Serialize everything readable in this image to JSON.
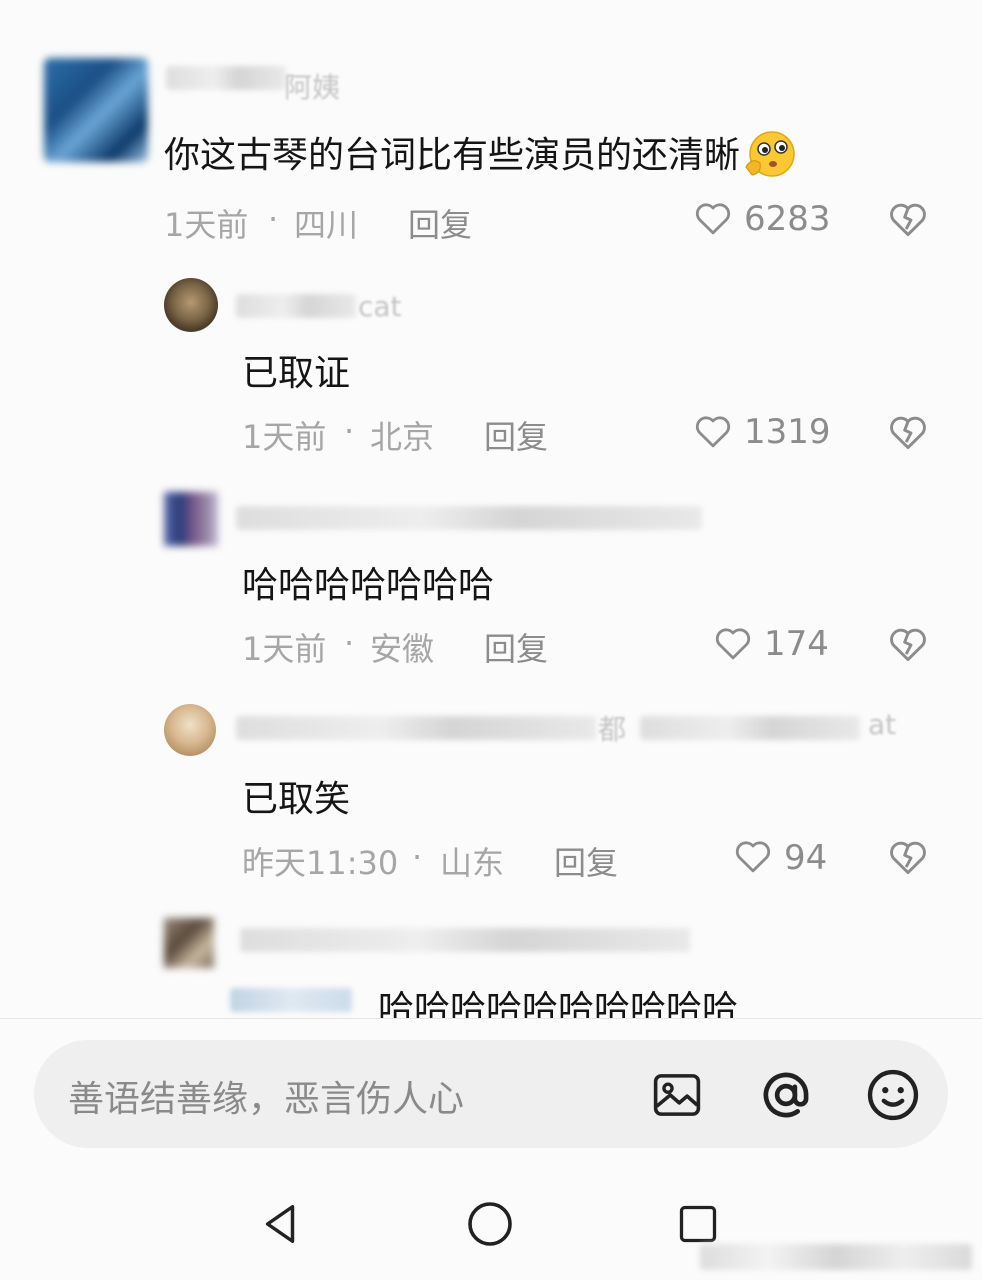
{
  "comments": [
    {
      "username_fragment": "阿姨",
      "text": "你这古琴的台词比有些演员的还清晰",
      "emoji": "thinking-face-emoji",
      "time": "1天前",
      "location": "四川",
      "reply_label": "回复",
      "likes": "6283"
    },
    {
      "username_fragment": "cat",
      "text": "已取证",
      "time": "1天前",
      "location": "北京",
      "reply_label": "回复",
      "likes": "1319"
    },
    {
      "text": "哈哈哈哈哈哈哈",
      "time": "1天前",
      "location": "安徽",
      "reply_label": "回复",
      "likes": "174"
    },
    {
      "username_fragment": "都",
      "username_fragment_2": "at",
      "text": "已取笑",
      "time": "昨天11:30",
      "location": "山东",
      "reply_label": "回复",
      "likes": "94"
    },
    {
      "text": "哈哈哈哈哈哈哈哈哈哈"
    }
  ],
  "meta_separator": "·",
  "input": {
    "placeholder": "善语结善缘，恶言伤人心",
    "icons": [
      "image-icon",
      "at-icon",
      "emoji-icon"
    ]
  },
  "nav": {
    "icons": [
      "back-triangle-icon",
      "home-circle-icon",
      "recents-square-icon"
    ]
  },
  "colors": {
    "background": "#fbfbfb",
    "text_primary": "#151515",
    "text_meta": "#a6a6a6",
    "input_bg": "#efefef"
  }
}
